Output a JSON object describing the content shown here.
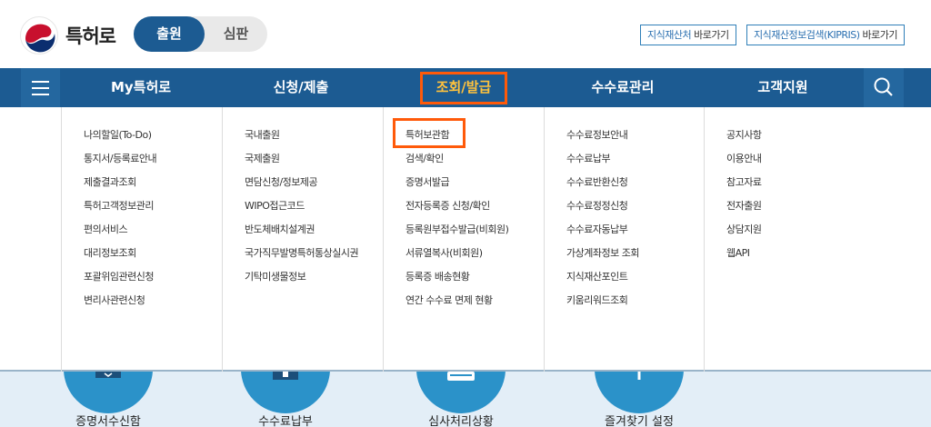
{
  "header": {
    "logo_text": "특허로",
    "mode_active": "출원",
    "mode_inactive": "심판",
    "quick_links": [
      {
        "label_blue": "지식재산처",
        "label_rest": " 바로가기"
      },
      {
        "label_blue": "지식재산정보검색(KIPRIS)",
        "label_rest": " 바로가기"
      }
    ]
  },
  "nav": {
    "menu_icon": "hamburger-icon",
    "search_icon": "search-icon",
    "items": [
      "My특허로",
      "신청/제출",
      "조회/발급",
      "수수료관리",
      "고객지원"
    ],
    "active_index": 2,
    "highlight_color": "#ff5a0a",
    "active_color": "#ffc23d",
    "bar_color": "#1c5b92"
  },
  "dropdown": {
    "columns": [
      [
        "나의할일(To-Do)",
        "통지서/등록료안내",
        "제출결과조회",
        "특허고객정보관리",
        "편의서비스",
        "대리정보조회",
        "포괄위임관련신청",
        "변리사관련신청"
      ],
      [
        "국내출원",
        "국제출원",
        "면담신청/정보제공",
        "WIPO접근코드",
        "반도체배치설계권",
        "국가직무발명특허통상실시권",
        "기탁미생물정보"
      ],
      [
        "특허보관함",
        "검색/확인",
        "증명서발급",
        "전자등록증 신청/확인",
        "등록원부접수발급(비회원)",
        "서류열복사(비회원)",
        "등록증 배송현황",
        "연간 수수료 면제 현황"
      ],
      [
        "수수료정보안내",
        "수수료납부",
        "수수료반환신청",
        "수수료정정신청",
        "수수료자동납부",
        "가상계좌정보 조회",
        "지식재산포인트",
        "키움리워드조회"
      ],
      [
        "공지사항",
        "이용안내",
        "참고자료",
        "전자출원",
        "상담지원",
        "웹API"
      ]
    ]
  },
  "services": [
    {
      "label": "증명서수신함",
      "icon": "certificate-icon"
    },
    {
      "label": "수수료납부",
      "icon": "payment-icon"
    },
    {
      "label": "심사처리상황",
      "icon": "status-icon"
    },
    {
      "label": "즐겨찾기 설정",
      "icon": "star-icon"
    }
  ]
}
